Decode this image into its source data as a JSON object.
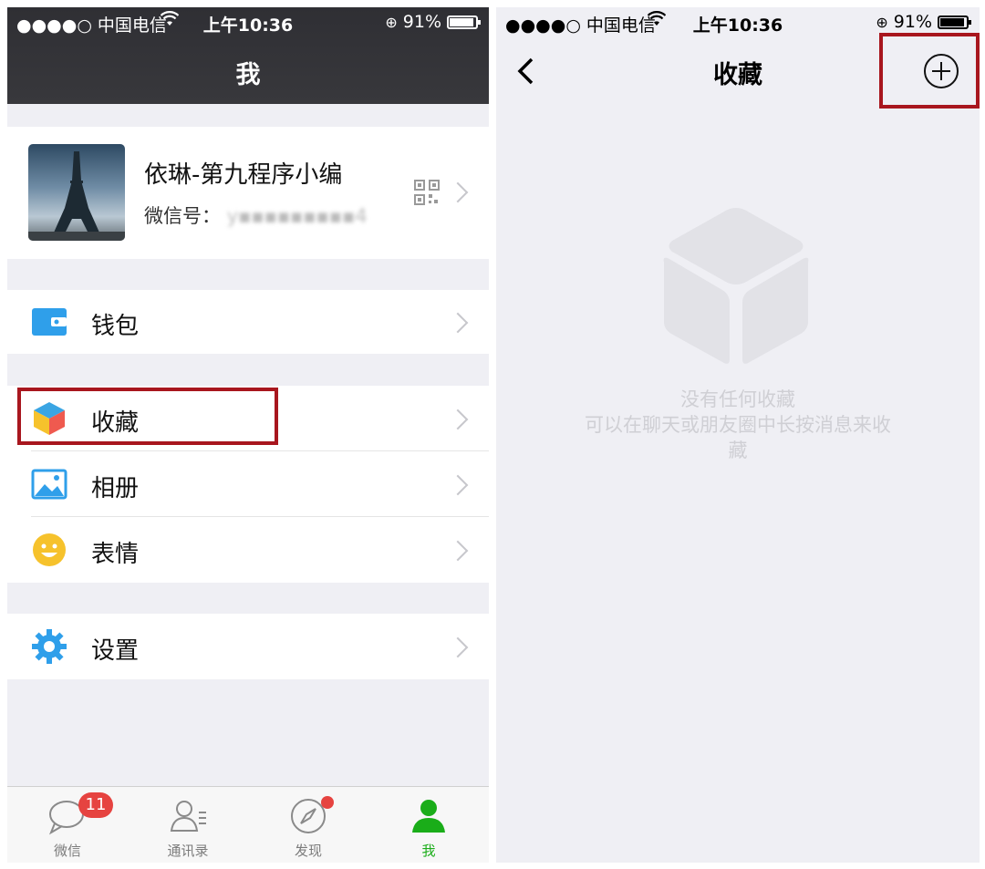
{
  "left": {
    "status": {
      "carrier": "●●●●○ 中国电信",
      "time": "上午10:36",
      "battery": "91%"
    },
    "title": "我",
    "profile": {
      "name": "依琳-第九程序小编",
      "wechat_id_label": "微信号：",
      "wechat_id_value": "y▪▪▪▪▪▪▪▪▪4"
    },
    "menu": {
      "wallet": "钱包",
      "favorites": "收藏",
      "album": "相册",
      "stickers": "表情",
      "settings": "设置"
    },
    "tabs": [
      {
        "label": "微信",
        "badge": "11"
      },
      {
        "label": "通讯录"
      },
      {
        "label": "发现"
      },
      {
        "label": "我"
      }
    ],
    "colors": {
      "accent": "#1aad19",
      "highlight": "#a8161e",
      "badge": "#e64340"
    }
  },
  "right": {
    "status": {
      "carrier": "●●●●○ 中国电信",
      "time": "上午10:36",
      "battery": "91%"
    },
    "title": "收藏",
    "back_icon": "chevron-left-icon",
    "add_icon": "plus-circle-icon",
    "empty": {
      "line1": "没有任何收藏",
      "line2": "可以在聊天或朋友圈中长按消息来收",
      "line3": "藏"
    }
  }
}
